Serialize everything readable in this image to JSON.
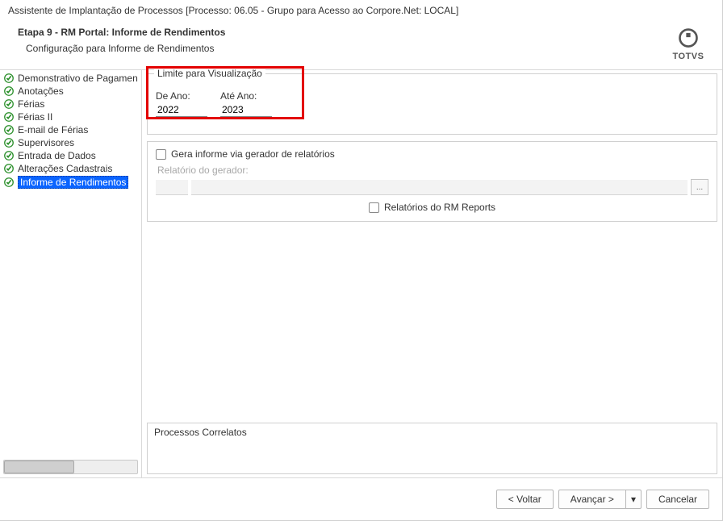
{
  "window_title": "Assistente de Implantação de Processos [Processo: 06.05 - Grupo para Acesso ao Corpore.Net: LOCAL]",
  "header": {
    "title": "Etapa 9 - RM Portal: Informe de Rendimentos",
    "subtitle": "Configuração para Informe de Rendimentos"
  },
  "logo_text": "TOTVS",
  "sidebar": {
    "items": [
      {
        "label": "Demonstrativo de Pagamen",
        "selected": false
      },
      {
        "label": "Anotações",
        "selected": false
      },
      {
        "label": "Férias",
        "selected": false
      },
      {
        "label": "Férias II",
        "selected": false
      },
      {
        "label": "E-mail de Férias",
        "selected": false
      },
      {
        "label": "Supervisores",
        "selected": false
      },
      {
        "label": "Entrada de Dados",
        "selected": false
      },
      {
        "label": "Alterações Cadastrais",
        "selected": false
      },
      {
        "label": "Informe de Rendimentos",
        "selected": true
      }
    ]
  },
  "limit_group": {
    "legend": "Limite para Visualização",
    "from_label": "De Ano:",
    "to_label": "Até Ano:",
    "from_value": "2022",
    "to_value": "2023"
  },
  "generator": {
    "checkbox_label": "Gera informe via gerador de relatórios",
    "checked": false,
    "field_label": "Relatório do gerador:",
    "browse_label": "...",
    "reports_checkbox_label": "Relatórios do RM Reports",
    "reports_checked": false
  },
  "correlatos_label": "Processos Correlatos",
  "buttons": {
    "back": "< Voltar",
    "next": "Avançar >",
    "dropdown_icon": "▾",
    "cancel": "Cancelar"
  }
}
